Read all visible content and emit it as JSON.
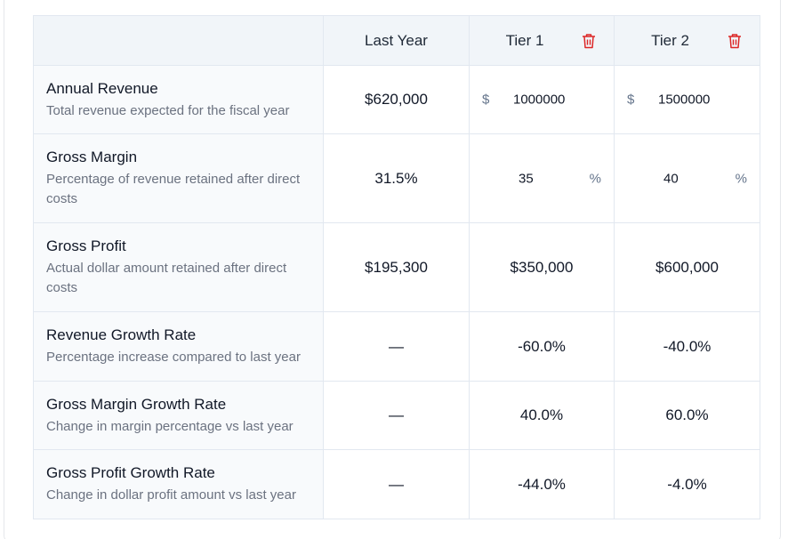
{
  "header": {
    "col_last_year": "Last Year",
    "col_tier1": "Tier 1",
    "col_tier2": "Tier 2"
  },
  "rows": {
    "annual_revenue": {
      "title": "Annual Revenue",
      "desc": "Total revenue expected for the fiscal year",
      "last_year": "$620,000",
      "currency_symbol": "$",
      "tier1": "1000000",
      "tier2": "1500000"
    },
    "gross_margin": {
      "title": "Gross Margin",
      "desc": "Percentage of revenue retained after direct costs",
      "last_year": "31.5%",
      "percent_symbol": "%",
      "tier1": "35",
      "tier2": "40"
    },
    "gross_profit": {
      "title": "Gross Profit",
      "desc": "Actual dollar amount retained after direct costs",
      "last_year": "$195,300",
      "tier1": "$350,000",
      "tier2": "$600,000"
    },
    "revenue_growth": {
      "title": "Revenue Growth Rate",
      "desc": "Percentage increase compared to last year",
      "last_year": "—",
      "tier1": "-60.0%",
      "tier2": "-40.0%"
    },
    "margin_growth": {
      "title": "Gross Margin Growth Rate",
      "desc": "Change in margin percentage vs last year",
      "last_year": "—",
      "tier1": "40.0%",
      "tier2": "60.0%"
    },
    "profit_growth": {
      "title": "Gross Profit Growth Rate",
      "desc": "Change in dollar profit amount vs last year",
      "last_year": "—",
      "tier1": "-44.0%",
      "tier2": "-4.0%"
    }
  },
  "colors": {
    "negative": "#dc2626",
    "positive": "#16a34a",
    "trash": "#dc2626",
    "header_bg": "#f1f5f9",
    "label_bg": "#f8fafc"
  },
  "icons": {
    "delete": "trash-icon"
  }
}
